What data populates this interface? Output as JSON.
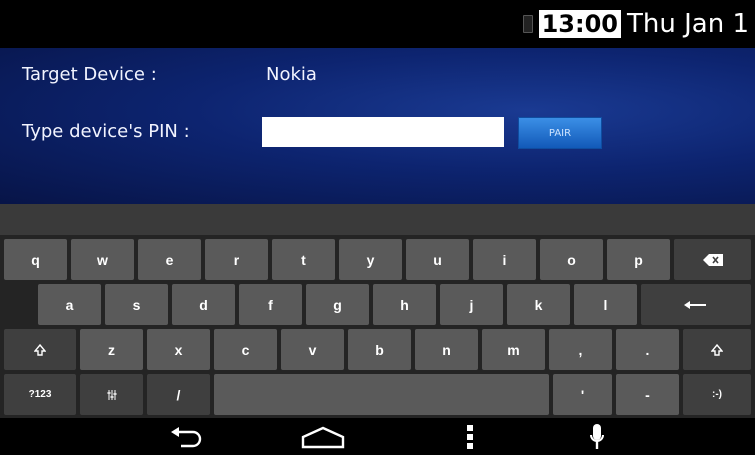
{
  "status_bar": {
    "time": "13:00",
    "date": "Thu Jan 1"
  },
  "pairing": {
    "target_label": "Target Device :",
    "target_value": "Nokia",
    "pin_label": "Type device's PIN :",
    "pin_value": "",
    "pair_button": "PAIR"
  },
  "keyboard": {
    "row1": [
      "q",
      "w",
      "e",
      "r",
      "t",
      "y",
      "u",
      "i",
      "o",
      "p"
    ],
    "row2": [
      "a",
      "s",
      "d",
      "f",
      "g",
      "h",
      "j",
      "k",
      "l"
    ],
    "row3": [
      "z",
      "x",
      "c",
      "v",
      "b",
      "n",
      "m",
      ",",
      "."
    ],
    "symbols_key": "?123",
    "slash_key": "/",
    "apostrophe_key": "'",
    "dash_key": "-",
    "smiley_key": ":-)"
  },
  "icons": {
    "backspace": "backspace-icon",
    "enter": "enter-icon",
    "shift": "shift-icon",
    "settings": "keyboard-settings-icon",
    "back": "back-icon",
    "home": "home-icon",
    "menu": "menu-icon",
    "mic": "microphone-icon"
  }
}
